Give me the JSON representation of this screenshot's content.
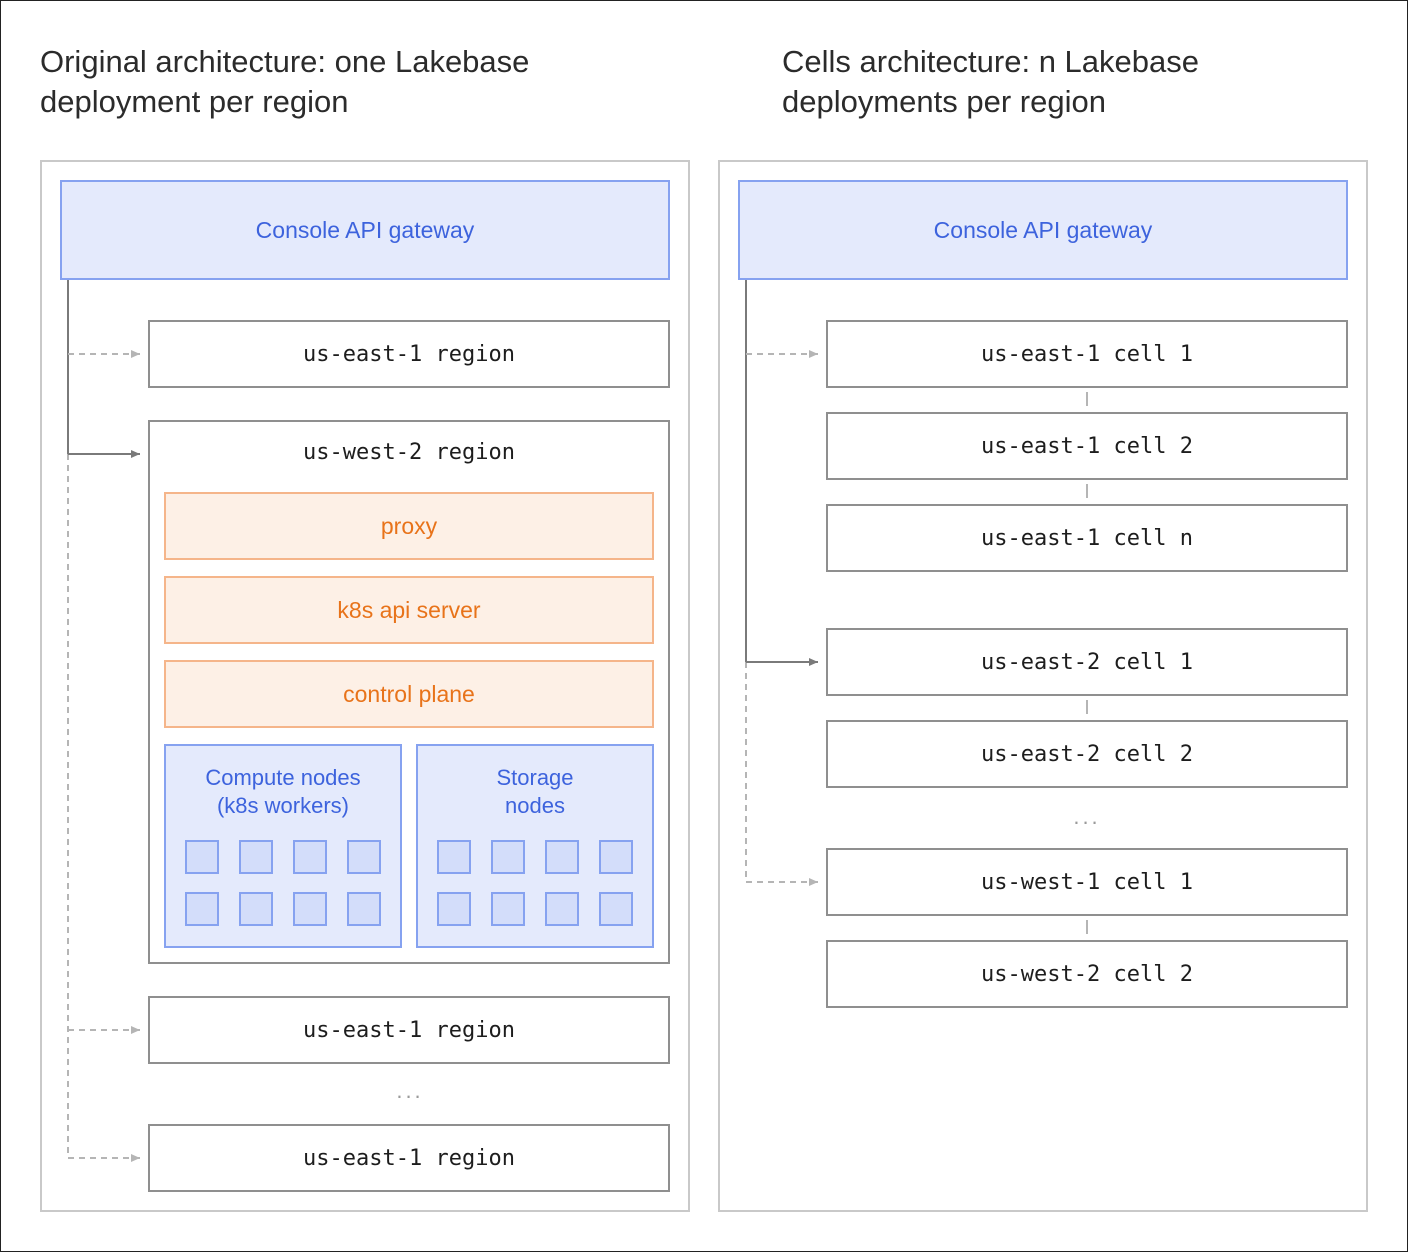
{
  "left": {
    "title_line1": "Original architecture: one Lakebase",
    "title_line2": "deployment per region",
    "gateway": "Console API gateway",
    "region_top": "us-east-1 region",
    "region_main": "us-west-2 region",
    "layers": [
      "proxy",
      "k8s api server",
      "control plane"
    ],
    "compute_label_1": "Compute nodes",
    "compute_label_2": "(k8s workers)",
    "storage_label_1": "Storage",
    "storage_label_2": "nodes",
    "region_bottom_1": "us-east-1 region",
    "ellipsis": "...",
    "region_bottom_2": "us-east-1 region"
  },
  "right": {
    "title_line1": "Cells architecture: n Lakebase",
    "title_line2": "deployments per region",
    "gateway": "Console API gateway",
    "cells": [
      "us-east-1 cell 1",
      "us-east-1 cell 2",
      "us-east-1 cell n",
      "us-east-2 cell 1",
      "us-east-2 cell 2",
      "us-west-1 cell 1",
      "us-west-2 cell 2"
    ],
    "ellipsis": "..."
  },
  "colors": {
    "gateway_fill": "#e4eafc",
    "gateway_border": "#86a2f0",
    "gateway_text": "#3d63dd",
    "orange_fill": "#fdf0e6",
    "orange_border": "#f5b58a",
    "orange_text": "#e8731a",
    "region_border": "#8f8f8f"
  }
}
